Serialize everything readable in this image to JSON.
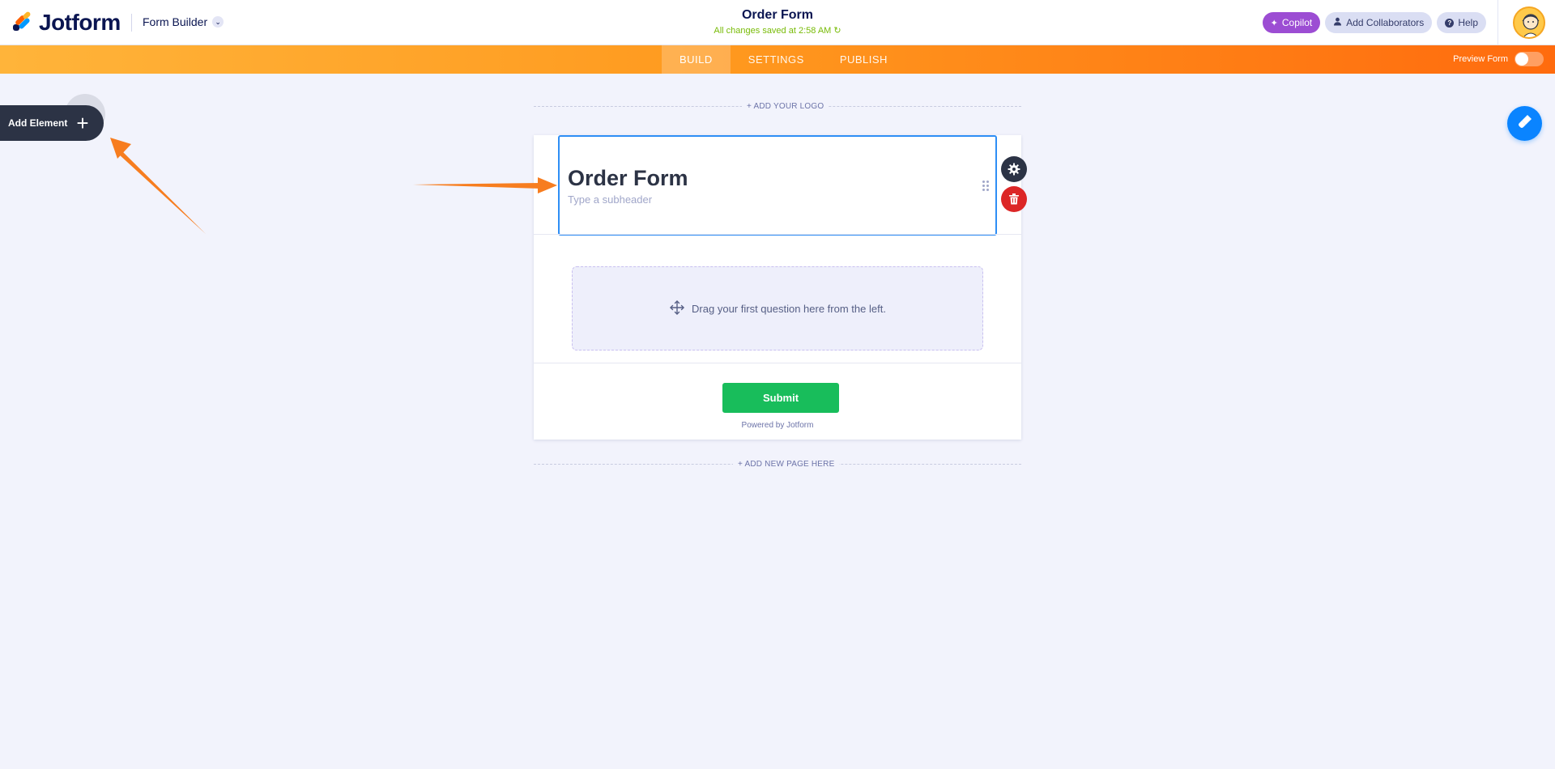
{
  "brand": {
    "name": "Jotform"
  },
  "header": {
    "builder_menu_label": "Form Builder",
    "form_title": "Order Form",
    "save_status": "All changes saved at 2:58 AM",
    "copilot_label": "Copilot",
    "collaborators_label": "Add Collaborators",
    "help_label": "Help"
  },
  "nav": {
    "tabs": [
      {
        "label": "BUILD",
        "active": true
      },
      {
        "label": "SETTINGS",
        "active": false
      },
      {
        "label": "PUBLISH",
        "active": false
      }
    ],
    "preview_label": "Preview Form",
    "preview_on": false
  },
  "sidebar": {
    "add_element_label": "Add Element"
  },
  "form": {
    "add_logo_label": "+ ADD YOUR LOGO",
    "heading": "Order Form",
    "subheader_placeholder": "Type a subheader",
    "drop_zone_text": "Drag your first question here from the left.",
    "submit_label": "Submit",
    "powered_by": "Powered by Jotform",
    "add_page_label": "+ ADD NEW PAGE HERE"
  },
  "colors": {
    "accent_orange": "#ff6b0e",
    "submit_green": "#18bd5b",
    "selection_blue": "#2e8ef5",
    "copilot_purple": "#9c4dd3",
    "delete_red": "#dc2626",
    "annotation_arrow": "#f77d1f"
  },
  "icons": [
    "jotform-logo-icon",
    "chevron-down-icon",
    "sparkle-icon",
    "user-icon",
    "help-icon",
    "plus-icon",
    "paint-roller-icon",
    "drag-handle-icon",
    "gear-icon",
    "trash-icon",
    "move-icon",
    "refresh-icon"
  ]
}
